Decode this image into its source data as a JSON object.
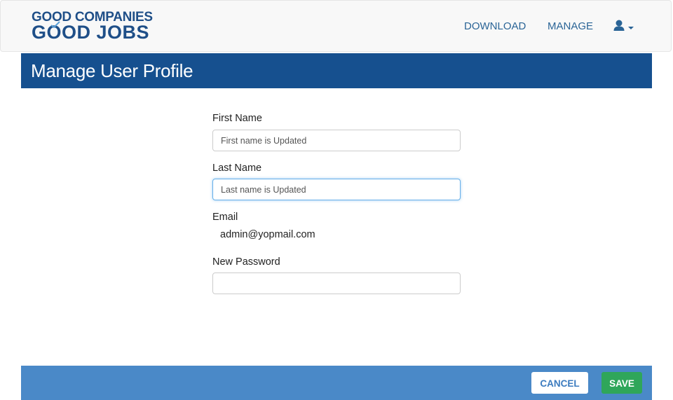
{
  "brand": {
    "line1": "GOOD COMPANIES",
    "line2": "GOOD JOBS",
    "color": "#1f4f88"
  },
  "nav": {
    "download": "DOWNLOAD",
    "manage": "MANAGE",
    "user_icon": "user-icon",
    "caret_icon": "caret-down-icon"
  },
  "page": {
    "title": "Manage User Profile",
    "banner_color": "#16508f"
  },
  "form": {
    "first_name_label": "First Name",
    "first_name_value": "First name is Updated",
    "last_name_label": "Last Name",
    "last_name_value": "Last name is Updated",
    "email_label": "Email",
    "email_value": "admin@yopmail.com",
    "password_label": "New Password",
    "password_value": ""
  },
  "footer": {
    "cancel_label": "CANCEL",
    "save_label": "SAVE",
    "bar_color": "#4a89c8",
    "save_color": "#2fa65a"
  }
}
